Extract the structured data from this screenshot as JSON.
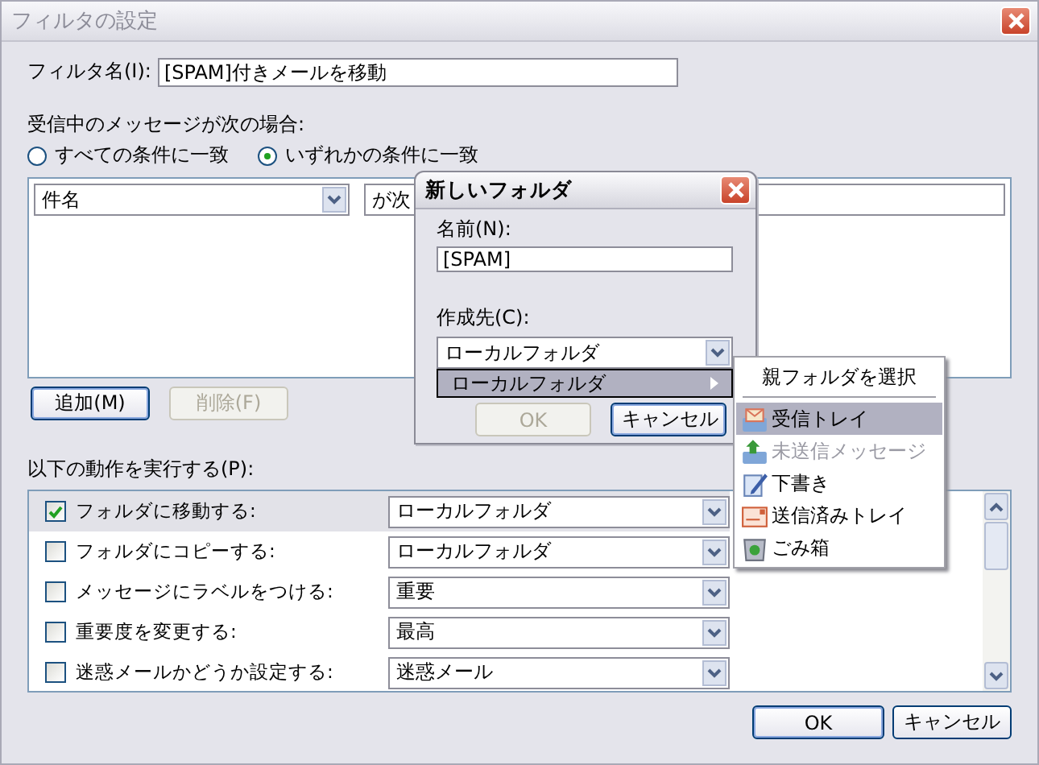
{
  "window": {
    "title": "フィルタの設定"
  },
  "filter_name": {
    "label": "フィルタ名(I):",
    "value": "[SPAM]付きメールを移動"
  },
  "match": {
    "label": "受信中のメッセージが次の場合:",
    "options": [
      {
        "label": "すべての条件に一致",
        "selected": false
      },
      {
        "label": "いずれかの条件に一致",
        "selected": true
      }
    ]
  },
  "conditions": [
    {
      "field": "件名",
      "operator": "が次"
    }
  ],
  "condition_buttons": [
    {
      "label": "追加(M)",
      "disabled": false
    },
    {
      "label": "削除(F)",
      "disabled": true
    }
  ],
  "actions": {
    "label": "以下の動作を実行する(P):",
    "rows": [
      {
        "label": "フォルダに移動する:",
        "checked": true,
        "selected": true,
        "value": "ローカルフォルダ"
      },
      {
        "label": "フォルダにコピーする:",
        "checked": false,
        "selected": false,
        "value": "ローカルフォルダ"
      },
      {
        "label": "メッセージにラベルをつける:",
        "checked": false,
        "selected": false,
        "value": "重要"
      },
      {
        "label": "重要度を変更する:",
        "checked": false,
        "selected": false,
        "value": "最高"
      },
      {
        "label": "迷惑メールかどうか設定する:",
        "checked": false,
        "selected": false,
        "value": "迷惑メール"
      }
    ]
  },
  "buttons": [
    "OK",
    "キャンセル"
  ],
  "new_folder_dialog": {
    "title": "新しいフォルダ",
    "name_label": "名前(N):",
    "name_value": "[SPAM]",
    "location_label": "作成先(C):",
    "location_value": "ローカルフォルダ",
    "location_list": [
      {
        "label": "ローカルフォルダ",
        "selected": true
      }
    ],
    "buttons": [
      {
        "label": "OK",
        "disabled": true
      },
      {
        "label": "キャンセル",
        "disabled": false
      }
    ]
  },
  "folder_menu": {
    "header": "親フォルダを選択",
    "items": [
      {
        "label": "受信トレイ",
        "kind": "inbox",
        "selected": true,
        "disabled": false
      },
      {
        "label": "未送信メッセージ",
        "kind": "outbox",
        "selected": false,
        "disabled": true
      },
      {
        "label": "下書き",
        "kind": "drafts",
        "selected": false,
        "disabled": false
      },
      {
        "label": "送信済みトレイ",
        "kind": "sent",
        "selected": false,
        "disabled": false
      },
      {
        "label": "ごみ箱",
        "kind": "trash",
        "selected": false,
        "disabled": false
      }
    ]
  }
}
